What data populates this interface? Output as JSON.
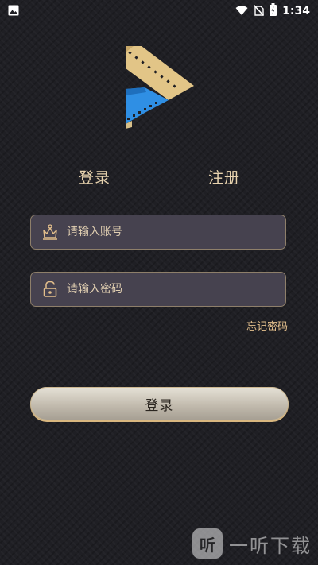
{
  "status_bar": {
    "time": "1:34",
    "icons": [
      "image-icon",
      "wifi-icon",
      "no-sim-icon",
      "battery-charging-icon"
    ]
  },
  "logo": {
    "icon": "play-film-logo-icon",
    "colors": {
      "gold": "#e2c587",
      "blue": "#2f8fe4"
    }
  },
  "tabs": {
    "login": "登录",
    "register": "注册"
  },
  "form": {
    "account": {
      "placeholder": "请输入账号",
      "value": "",
      "icon": "crown-user-icon"
    },
    "password": {
      "placeholder": "请输入密码",
      "value": "",
      "icon": "lock-icon"
    },
    "forgot_password": "忘记密码",
    "submit_label": "登录"
  },
  "watermark": {
    "badge": "听",
    "text": "一听下载"
  },
  "colors": {
    "accent": "#e8d3ae",
    "field_bg": "#46424f",
    "field_border": "#8e7f6a",
    "background": "#1f1f24"
  }
}
